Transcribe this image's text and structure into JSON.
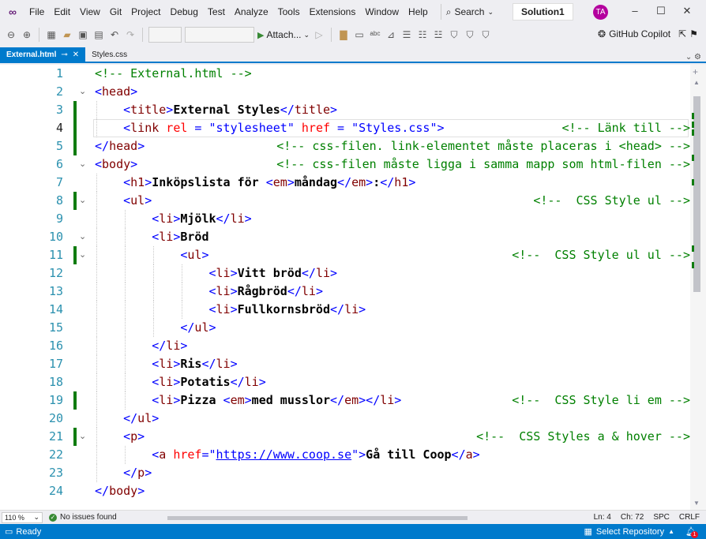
{
  "menubar": {
    "items": [
      "File",
      "Edit",
      "View",
      "Git",
      "Project",
      "Debug",
      "Test",
      "Analyze",
      "Tools",
      "Extensions",
      "Window",
      "Help"
    ],
    "search_label": "Search",
    "solution": "Solution1",
    "avatar_initials": "TA"
  },
  "toolbar": {
    "attach_label": "Attach...",
    "copilot_label": "GitHub Copilot"
  },
  "tabs": [
    {
      "label": "External.html",
      "active": true
    },
    {
      "label": "Styles.css",
      "active": false
    }
  ],
  "editor": {
    "line_numbers": [
      "1",
      "2",
      "3",
      "4",
      "5",
      "6",
      "7",
      "8",
      "9",
      "10",
      "11",
      "12",
      "13",
      "14",
      "15",
      "16",
      "17",
      "18",
      "19",
      "20",
      "21",
      "22",
      "23",
      "24"
    ],
    "current_line": 4,
    "lines": [
      {
        "indent": 0,
        "fold": "",
        "code": [
          [
            "cmt",
            "<!-- External.html -->"
          ]
        ],
        "right": ""
      },
      {
        "indent": 0,
        "fold": "v",
        "code": [
          [
            "br",
            "<"
          ],
          [
            "tag",
            "head"
          ],
          [
            "br",
            ">"
          ]
        ],
        "right": ""
      },
      {
        "indent": 1,
        "fold": "",
        "code": [
          [
            "br",
            "<"
          ],
          [
            "tag",
            "title"
          ],
          [
            "br",
            ">"
          ],
          [
            "txt",
            "External Styles"
          ],
          [
            "br",
            "</"
          ],
          [
            "tag",
            "title"
          ],
          [
            "br",
            ">"
          ]
        ],
        "right": ""
      },
      {
        "indent": 1,
        "fold": "",
        "code": [
          [
            "br",
            "<"
          ],
          [
            "tag",
            "link"
          ],
          [
            "txt",
            " "
          ],
          [
            "attr",
            "rel"
          ],
          [
            "br",
            " = "
          ],
          [
            "val",
            "\"stylesheet\""
          ],
          [
            "txt",
            " "
          ],
          [
            "attr",
            "href"
          ],
          [
            "br",
            " = "
          ],
          [
            "val",
            "\"Styles.css\""
          ],
          [
            "br",
            ">"
          ]
        ],
        "right": "<!-- Länk till -->"
      },
      {
        "indent": 0,
        "fold": "",
        "code": [
          [
            "br",
            "</"
          ],
          [
            "tag",
            "head"
          ],
          [
            "br",
            ">"
          ]
        ],
        "right": "<!-- css-filen. link-elementet måste placeras i <head> -->"
      },
      {
        "indent": 0,
        "fold": "v",
        "code": [
          [
            "br",
            "<"
          ],
          [
            "tag",
            "body"
          ],
          [
            "br",
            ">"
          ]
        ],
        "right": "<!-- css-filen måste ligga i samma mapp som html-filen -->"
      },
      {
        "indent": 1,
        "fold": "",
        "code": [
          [
            "br",
            "<"
          ],
          [
            "tag",
            "h1"
          ],
          [
            "br",
            ">"
          ],
          [
            "txt",
            "Inköpslista för "
          ],
          [
            "br",
            "<"
          ],
          [
            "tag",
            "em"
          ],
          [
            "br",
            ">"
          ],
          [
            "txt",
            "måndag"
          ],
          [
            "br",
            "</"
          ],
          [
            "tag",
            "em"
          ],
          [
            "br",
            ">"
          ],
          [
            "txt",
            ":"
          ],
          [
            "br",
            "</"
          ],
          [
            "tag",
            "h1"
          ],
          [
            "br",
            ">"
          ]
        ],
        "right": ""
      },
      {
        "indent": 1,
        "fold": "v",
        "code": [
          [
            "br",
            "<"
          ],
          [
            "tag",
            "ul"
          ],
          [
            "br",
            ">"
          ]
        ],
        "right": "<!--  CSS Style ul -->"
      },
      {
        "indent": 2,
        "fold": "",
        "code": [
          [
            "br",
            "<"
          ],
          [
            "tag",
            "li"
          ],
          [
            "br",
            ">"
          ],
          [
            "txt",
            "Mjölk"
          ],
          [
            "br",
            "</"
          ],
          [
            "tag",
            "li"
          ],
          [
            "br",
            ">"
          ]
        ],
        "right": ""
      },
      {
        "indent": 2,
        "fold": "v",
        "code": [
          [
            "br",
            "<"
          ],
          [
            "tag",
            "li"
          ],
          [
            "br",
            ">"
          ],
          [
            "txt",
            "Bröd"
          ]
        ],
        "right": ""
      },
      {
        "indent": 3,
        "fold": "v",
        "code": [
          [
            "br",
            "<"
          ],
          [
            "tag",
            "ul"
          ],
          [
            "br",
            ">"
          ]
        ],
        "right": "<!--  CSS Style ul ul -->"
      },
      {
        "indent": 4,
        "fold": "",
        "code": [
          [
            "br",
            "<"
          ],
          [
            "tag",
            "li"
          ],
          [
            "br",
            ">"
          ],
          [
            "txt",
            "Vitt bröd"
          ],
          [
            "br",
            "</"
          ],
          [
            "tag",
            "li"
          ],
          [
            "br",
            ">"
          ]
        ],
        "right": ""
      },
      {
        "indent": 4,
        "fold": "",
        "code": [
          [
            "br",
            "<"
          ],
          [
            "tag",
            "li"
          ],
          [
            "br",
            ">"
          ],
          [
            "txt",
            "Rågbröd"
          ],
          [
            "br",
            "</"
          ],
          [
            "tag",
            "li"
          ],
          [
            "br",
            ">"
          ]
        ],
        "right": ""
      },
      {
        "indent": 4,
        "fold": "",
        "code": [
          [
            "br",
            "<"
          ],
          [
            "tag",
            "li"
          ],
          [
            "br",
            ">"
          ],
          [
            "txt",
            "Fullkornsbröd"
          ],
          [
            "br",
            "</"
          ],
          [
            "tag",
            "li"
          ],
          [
            "br",
            ">"
          ]
        ],
        "right": ""
      },
      {
        "indent": 3,
        "fold": "",
        "code": [
          [
            "br",
            "</"
          ],
          [
            "tag",
            "ul"
          ],
          [
            "br",
            ">"
          ]
        ],
        "right": ""
      },
      {
        "indent": 2,
        "fold": "",
        "code": [
          [
            "br",
            "</"
          ],
          [
            "tag",
            "li"
          ],
          [
            "br",
            ">"
          ]
        ],
        "right": ""
      },
      {
        "indent": 2,
        "fold": "",
        "code": [
          [
            "br",
            "<"
          ],
          [
            "tag",
            "li"
          ],
          [
            "br",
            ">"
          ],
          [
            "txt",
            "Ris"
          ],
          [
            "br",
            "</"
          ],
          [
            "tag",
            "li"
          ],
          [
            "br",
            ">"
          ]
        ],
        "right": ""
      },
      {
        "indent": 2,
        "fold": "",
        "code": [
          [
            "br",
            "<"
          ],
          [
            "tag",
            "li"
          ],
          [
            "br",
            ">"
          ],
          [
            "txt",
            "Potatis"
          ],
          [
            "br",
            "</"
          ],
          [
            "tag",
            "li"
          ],
          [
            "br",
            ">"
          ]
        ],
        "right": ""
      },
      {
        "indent": 2,
        "fold": "",
        "code": [
          [
            "br",
            "<"
          ],
          [
            "tag",
            "li"
          ],
          [
            "br",
            ">"
          ],
          [
            "txt",
            "Pizza "
          ],
          [
            "br",
            "<"
          ],
          [
            "tag",
            "em"
          ],
          [
            "br",
            ">"
          ],
          [
            "txt",
            "med musslor"
          ],
          [
            "br",
            "</"
          ],
          [
            "tag",
            "em"
          ],
          [
            "br",
            "></"
          ],
          [
            "tag",
            "li"
          ],
          [
            "br",
            ">"
          ]
        ],
        "right": "<!--  CSS Style li em -->"
      },
      {
        "indent": 1,
        "fold": "",
        "code": [
          [
            "br",
            "</"
          ],
          [
            "tag",
            "ul"
          ],
          [
            "br",
            ">"
          ]
        ],
        "right": ""
      },
      {
        "indent": 1,
        "fold": "v",
        "code": [
          [
            "br",
            "<"
          ],
          [
            "tag",
            "p"
          ],
          [
            "br",
            ">"
          ]
        ],
        "right": "<!--  CSS Styles a & hover -->"
      },
      {
        "indent": 2,
        "fold": "",
        "code": [
          [
            "br",
            "<"
          ],
          [
            "tag",
            "a"
          ],
          [
            "txt",
            " "
          ],
          [
            "attr",
            "href"
          ],
          [
            "br",
            "="
          ],
          [
            "val",
            "\""
          ],
          [
            "link",
            "https://www.coop.se"
          ],
          [
            "val",
            "\""
          ],
          [
            "br",
            ">"
          ],
          [
            "txt",
            "Gå till Coop"
          ],
          [
            "br",
            "</"
          ],
          [
            "tag",
            "a"
          ],
          [
            "br",
            ">"
          ]
        ],
        "right": ""
      },
      {
        "indent": 1,
        "fold": "",
        "code": [
          [
            "br",
            "</"
          ],
          [
            "tag",
            "p"
          ],
          [
            "br",
            ">"
          ]
        ],
        "right": ""
      },
      {
        "indent": 0,
        "fold": "",
        "code": [
          [
            "br",
            "</"
          ],
          [
            "tag",
            "body"
          ],
          [
            "br",
            ">"
          ]
        ],
        "right": ""
      }
    ],
    "changed_lines": [
      3,
      4,
      5,
      8,
      11,
      19,
      21
    ]
  },
  "editor_status": {
    "zoom": "110 %",
    "issues": "No issues found",
    "ln": "Ln: 4",
    "ch": "Ch: 72",
    "spc": "SPC",
    "crlf": "CRLF"
  },
  "statusbar": {
    "ready": "Ready",
    "select_repo": "Select Repository",
    "notifications": "1"
  },
  "colors": {
    "accent": "#007acc",
    "line_number": "#2b91af",
    "tag": "#800000",
    "bracket": "#0000ff",
    "attr": "#ff0000",
    "comment": "#008000",
    "change_bar": "#107c10"
  }
}
